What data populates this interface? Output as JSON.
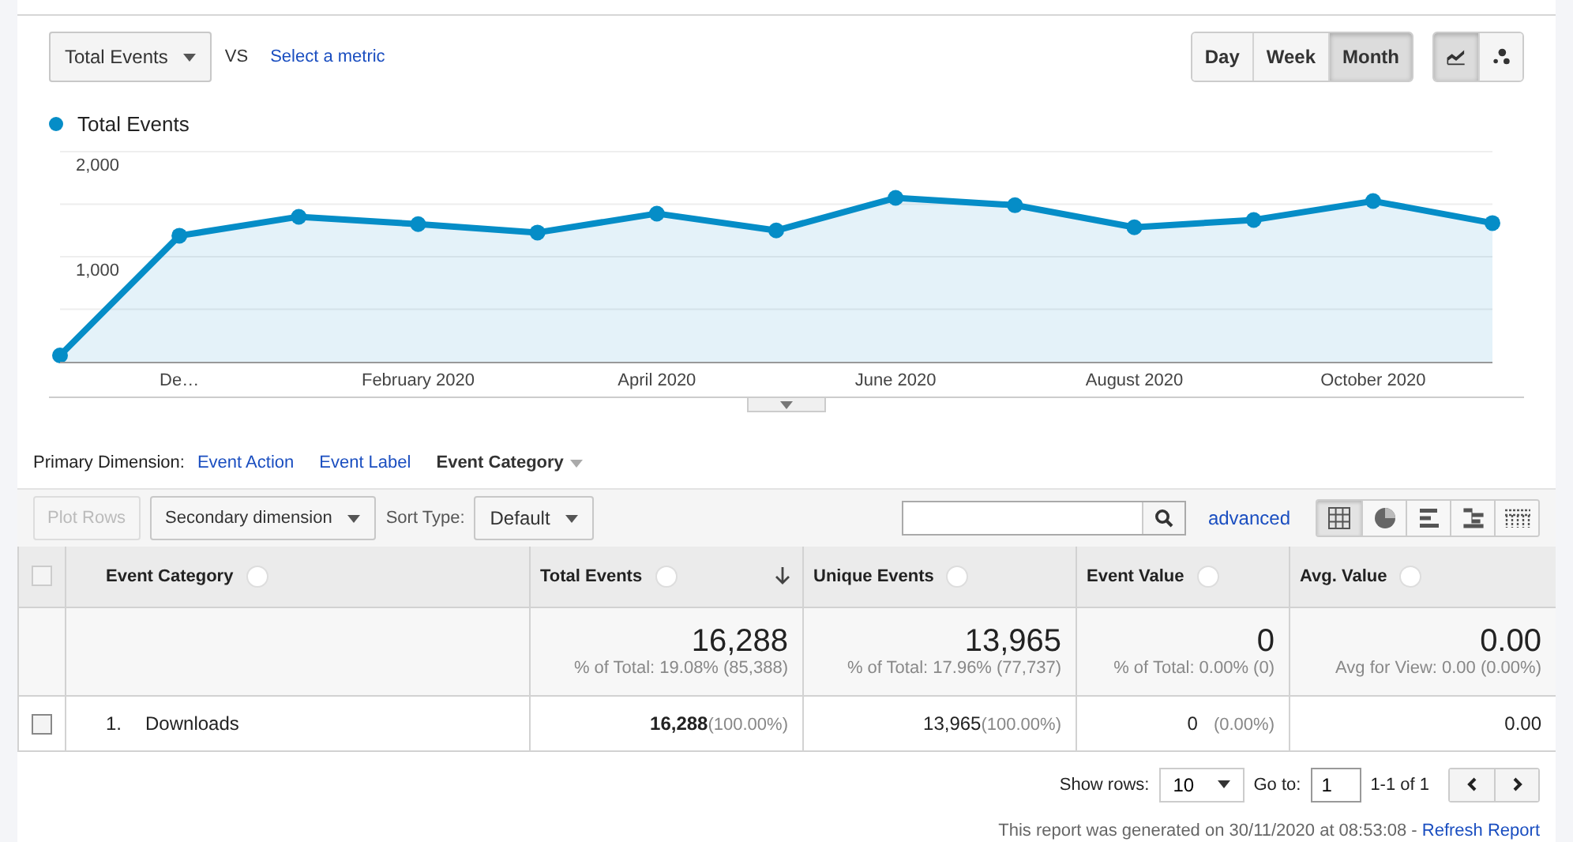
{
  "metric_selector": {
    "metric": "Total Events",
    "vs": "VS",
    "compare_link": "Select a metric"
  },
  "interval_buttons": [
    {
      "label": "Day",
      "selected": false
    },
    {
      "label": "Week",
      "selected": false
    },
    {
      "label": "Month",
      "selected": true
    }
  ],
  "chart_type_buttons": [
    {
      "kind": "line",
      "selected": true
    },
    {
      "kind": "motion",
      "selected": false
    }
  ],
  "chart_data": {
    "type": "area",
    "categories": [
      null,
      "De…",
      null,
      "February 2020",
      null,
      "April 2020",
      null,
      "June 2020",
      null,
      "August 2020",
      null,
      "October 2020",
      null
    ],
    "series": [
      {
        "name": "Total Events",
        "color": "#058dc7",
        "values": [
          60,
          1200,
          1380,
          1310,
          1230,
          1410,
          1250,
          1560,
          1490,
          1280,
          1350,
          1530,
          1320
        ]
      }
    ],
    "ylim": [
      0,
      2000
    ],
    "yticks": [
      {
        "value": 1000,
        "label": "1,000"
      },
      {
        "value": 2000,
        "label": "2,000"
      }
    ]
  },
  "primary_dimension": {
    "label": "Primary Dimension:",
    "options": [
      {
        "label": "Event Action",
        "selected": false
      },
      {
        "label": "Event Label",
        "selected": false
      },
      {
        "label": "Event Category",
        "selected": true
      }
    ]
  },
  "toolbar": {
    "plot_rows": {
      "label": "Plot Rows",
      "disabled": true
    },
    "secondary_dimension": "Secondary dimension",
    "sort_type_label": "Sort Type:",
    "sort_type": "Default",
    "advanced": "advanced",
    "view_buttons": [
      {
        "kind": "table",
        "selected": true
      },
      {
        "kind": "pie",
        "selected": false
      },
      {
        "kind": "bars",
        "selected": false
      },
      {
        "kind": "comparison",
        "selected": false
      },
      {
        "kind": "pivot",
        "selected": false
      }
    ]
  },
  "table": {
    "header_checked": false,
    "columns": [
      {
        "label": "Event Category",
        "sorted": false
      },
      {
        "label": "Total Events",
        "sorted": true
      },
      {
        "label": "Unique Events",
        "sorted": false
      },
      {
        "label": "Event Value",
        "sorted": false
      },
      {
        "label": "Avg. Value",
        "sorted": false
      }
    ],
    "totals": [
      {
        "value": "16,288",
        "note": "% of Total: 19.08% (85,388)"
      },
      {
        "value": "13,965",
        "note": "% of Total: 17.96% (77,737)"
      },
      {
        "value": "0",
        "note": "% of Total: 0.00% (0)"
      },
      {
        "value": "0.00",
        "note": "Avg for View: 0.00 (0.00%)"
      }
    ],
    "rows": [
      {
        "checked": false,
        "cells": [
          {
            "index": "1.",
            "value": "Downloads"
          },
          {
            "value": "16,288",
            "share": "(100.00%)"
          },
          {
            "value": "13,965",
            "share": "(100.00%)"
          },
          {
            "value": "0",
            "share": "(0.00%)"
          },
          {
            "value": "0.00"
          }
        ]
      }
    ]
  },
  "pagination": {
    "show_rows_label": "Show rows:",
    "rows_per_page": "10",
    "goto_label": "Go to:",
    "page": "1",
    "range": "1-1 of 1"
  },
  "footer": {
    "note": "This report was generated on 30/11/2020 at 08:53:08 - ",
    "link": "Refresh Report"
  }
}
